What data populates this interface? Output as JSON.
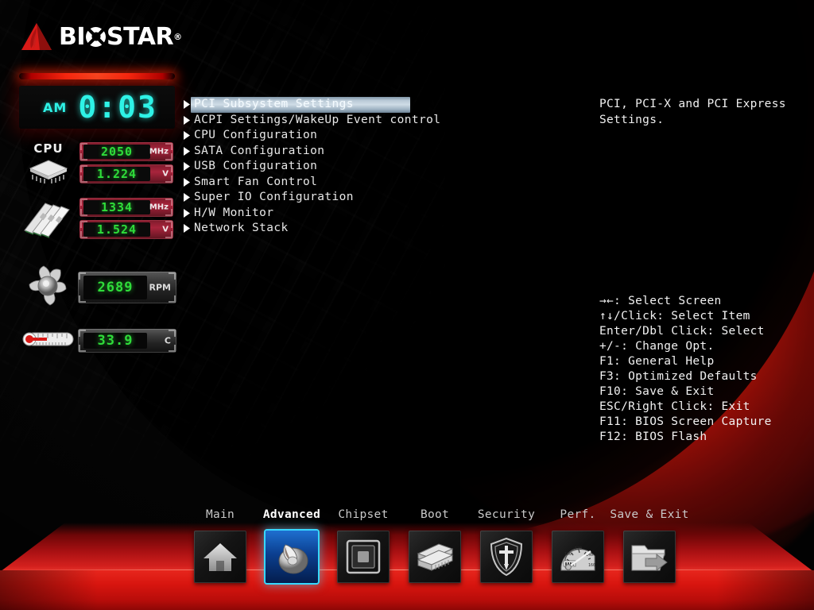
{
  "brand": {
    "name_part1": "BI",
    "name_o": "O",
    "name_part2": "STAR",
    "registered": "®"
  },
  "monitor": {
    "clock": {
      "ampm": "AM",
      "time": "0:03"
    },
    "cpu": {
      "label": "CPU",
      "icon": "cpu-chip-icon",
      "frequency": {
        "value": "2050",
        "unit": "MHz"
      },
      "voltage": {
        "value": "1.224",
        "unit": "V"
      }
    },
    "memory": {
      "icon": "memory-dimm-icon",
      "frequency": {
        "value": "1334",
        "unit": "MHz"
      },
      "voltage": {
        "value": "1.524",
        "unit": "V"
      }
    },
    "fan": {
      "icon": "fan-icon",
      "speed": {
        "value": "2689",
        "unit": "RPM"
      }
    },
    "temperature": {
      "icon": "thermometer-icon",
      "reading": {
        "value": "33.9",
        "unit": "C"
      }
    }
  },
  "menu": {
    "items": [
      {
        "label": "PCI Subsystem Settings",
        "selected": true
      },
      {
        "label": "ACPI Settings/WakeUp Event control",
        "selected": false
      },
      {
        "label": "CPU Configuration",
        "selected": false
      },
      {
        "label": "SATA Configuration",
        "selected": false
      },
      {
        "label": "USB Configuration",
        "selected": false
      },
      {
        "label": "Smart Fan Control",
        "selected": false
      },
      {
        "label": "Super IO Configuration",
        "selected": false
      },
      {
        "label": "H/W Monitor",
        "selected": false
      },
      {
        "label": "Network Stack",
        "selected": false
      }
    ]
  },
  "help": {
    "line1": "PCI, PCI-X and PCI Express",
    "line2": "Settings."
  },
  "legend": {
    "lines": [
      "→←: Select Screen",
      "↑↓/Click: Select Item",
      "Enter/Dbl Click: Select",
      "+/-: Change Opt.",
      "F1: General Help",
      "F3: Optimized Defaults",
      "F10: Save & Exit",
      "ESC/Right Click: Exit",
      "F11: BIOS Screen Capture",
      "F12: BIOS Flash"
    ]
  },
  "nav": {
    "tabs": [
      {
        "label": "Main",
        "icon": "home-icon",
        "active": false
      },
      {
        "label": "Advanced",
        "icon": "knob-dial-icon",
        "active": true
      },
      {
        "label": "Chipset",
        "icon": "chipset-square-icon",
        "active": false
      },
      {
        "label": "Boot",
        "icon": "disk-stack-icon",
        "active": false
      },
      {
        "label": "Security",
        "icon": "shield-sword-icon",
        "active": false
      },
      {
        "label": "Perf.",
        "icon": "speedometer-icon",
        "active": false
      },
      {
        "label": "Save & Exit",
        "icon": "folder-arrow-icon",
        "active": false
      }
    ]
  },
  "colors": {
    "accent_red": "#d8150f",
    "digit_green": "#2fdc3a",
    "clock_cyan": "#2ef2e6",
    "active_blue": "#37d8ff",
    "highlight_bar": "#cfdce6"
  }
}
